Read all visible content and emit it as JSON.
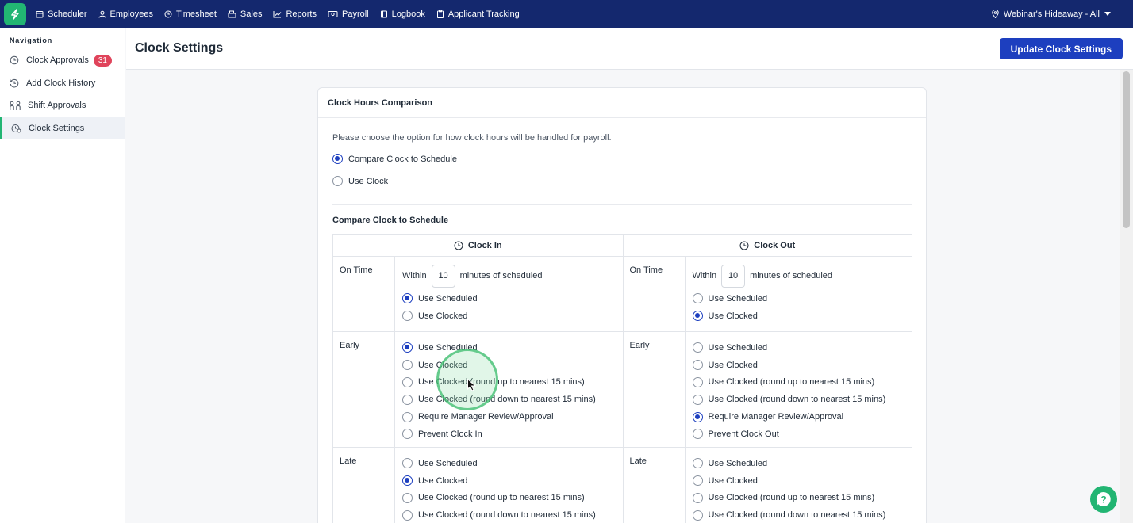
{
  "topnav": {
    "items": [
      {
        "label": "Scheduler",
        "icon": "calendar-icon"
      },
      {
        "label": "Employees",
        "icon": "person-icon"
      },
      {
        "label": "Timesheet",
        "icon": "clock-icon"
      },
      {
        "label": "Sales",
        "icon": "register-icon"
      },
      {
        "label": "Reports",
        "icon": "chart-icon"
      },
      {
        "label": "Payroll",
        "icon": "money-icon"
      },
      {
        "label": "Logbook",
        "icon": "book-icon"
      },
      {
        "label": "Applicant Tracking",
        "icon": "clipboard-icon"
      }
    ],
    "location": "Webinar's Hideaway - All"
  },
  "sidebar": {
    "title": "Navigation",
    "items": [
      {
        "label": "Clock Approvals",
        "badge": "31"
      },
      {
        "label": "Add Clock History"
      },
      {
        "label": "Shift Approvals"
      },
      {
        "label": "Clock Settings",
        "active": true
      }
    ]
  },
  "header": {
    "title": "Clock Settings",
    "update_button": "Update Clock Settings"
  },
  "card": {
    "title": "Clock Hours Comparison",
    "description": "Please choose the option for how clock hours will be handled for payroll.",
    "options": [
      {
        "label": "Compare Clock to Schedule",
        "selected": true
      },
      {
        "label": "Use Clock",
        "selected": false
      }
    ],
    "section_title": "Compare Clock to Schedule",
    "columns": {
      "clock_in": "Clock In",
      "clock_out": "Clock Out"
    },
    "within_label": "Within",
    "within_suffix": "minutes of scheduled",
    "clock_in_minutes": "10",
    "clock_out_minutes": "10",
    "rows": {
      "on_time": {
        "label": "On Time",
        "clock_in": [
          "Use Scheduled",
          "Use Clocked"
        ],
        "clock_in_selected": 0,
        "clock_out": [
          "Use Scheduled",
          "Use Clocked"
        ],
        "clock_out_selected": 1
      },
      "early": {
        "label": "Early",
        "clock_in": [
          "Use Scheduled",
          "Use Clocked",
          "Use Clocked (round up to nearest 15 mins)",
          "Use Clocked (round down to nearest 15 mins)",
          "Require Manager Review/Approval",
          "Prevent Clock In"
        ],
        "clock_in_selected": 0,
        "clock_out": [
          "Use Scheduled",
          "Use Clocked",
          "Use Clocked (round up to nearest 15 mins)",
          "Use Clocked (round down to nearest 15 mins)",
          "Require Manager Review/Approval",
          "Prevent Clock Out"
        ],
        "clock_out_selected": 4
      },
      "late": {
        "label": "Late",
        "clock_in": [
          "Use Scheduled",
          "Use Clocked",
          "Use Clocked (round up to nearest 15 mins)",
          "Use Clocked (round down to nearest 15 mins)"
        ],
        "clock_in_selected": 1,
        "clock_out": [
          "Use Scheduled",
          "Use Clocked",
          "Use Clocked (round up to nearest 15 mins)",
          "Use Clocked (round down to nearest 15 mins)"
        ],
        "clock_out_selected": -1
      }
    }
  },
  "colors": {
    "nav_bg": "#14286e",
    "brand_green": "#22b573",
    "primary_blue": "#1d3fbf",
    "badge_red": "#e0445b"
  }
}
